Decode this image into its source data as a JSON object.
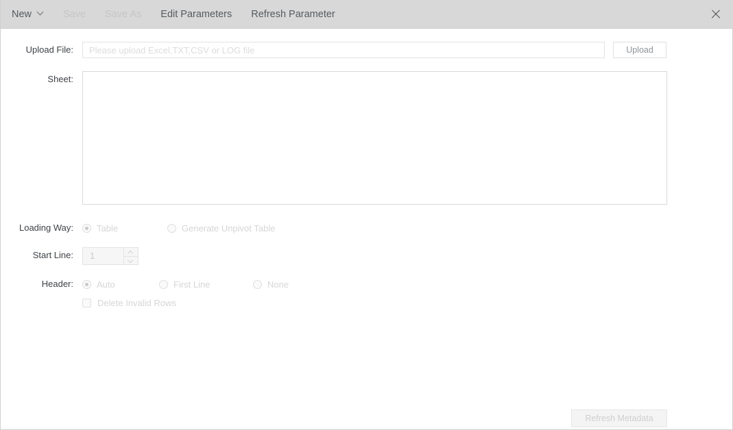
{
  "toolbar": {
    "new_label": "New",
    "new_caret_icon": "chevron-down-icon",
    "save_label": "Save",
    "save_as_label": "Save As",
    "edit_parameters_label": "Edit Parameters",
    "refresh_parameter_label": "Refresh Parameter",
    "close_icon": "close-icon"
  },
  "form": {
    "upload": {
      "label": "Upload File:",
      "placeholder": "Please upload Excel,TXT,CSV or LOG file",
      "value": "",
      "button_label": "Upload"
    },
    "sheet": {
      "label": "Sheet:",
      "value": ""
    },
    "loading_way": {
      "label": "Loading Way:",
      "options": [
        {
          "label": "Table",
          "selected": true
        },
        {
          "label": "Generate Unpivot Table",
          "selected": false
        }
      ]
    },
    "start_line": {
      "label": "Start Line:",
      "value": "1",
      "up_icon": "chevron-up-icon",
      "down_icon": "chevron-down-icon"
    },
    "header": {
      "label": "Header:",
      "options": [
        {
          "label": "Auto",
          "selected": true
        },
        {
          "label": "First Line",
          "selected": false
        },
        {
          "label": "None",
          "selected": false
        }
      ]
    },
    "delete_invalid_rows": {
      "label": "Delete Invalid Rows",
      "checked": false
    }
  },
  "footer": {
    "refresh_metadata_label": "Refresh Metadata"
  },
  "colors": {
    "toolbar_bg": "#d8d8d8",
    "menu_text": "#555a5e",
    "menu_disabled": "#c6c6c6",
    "body_bg": "#ffffff",
    "disabled_text": "#d6d6d6",
    "border": "#e2e2e2"
  }
}
